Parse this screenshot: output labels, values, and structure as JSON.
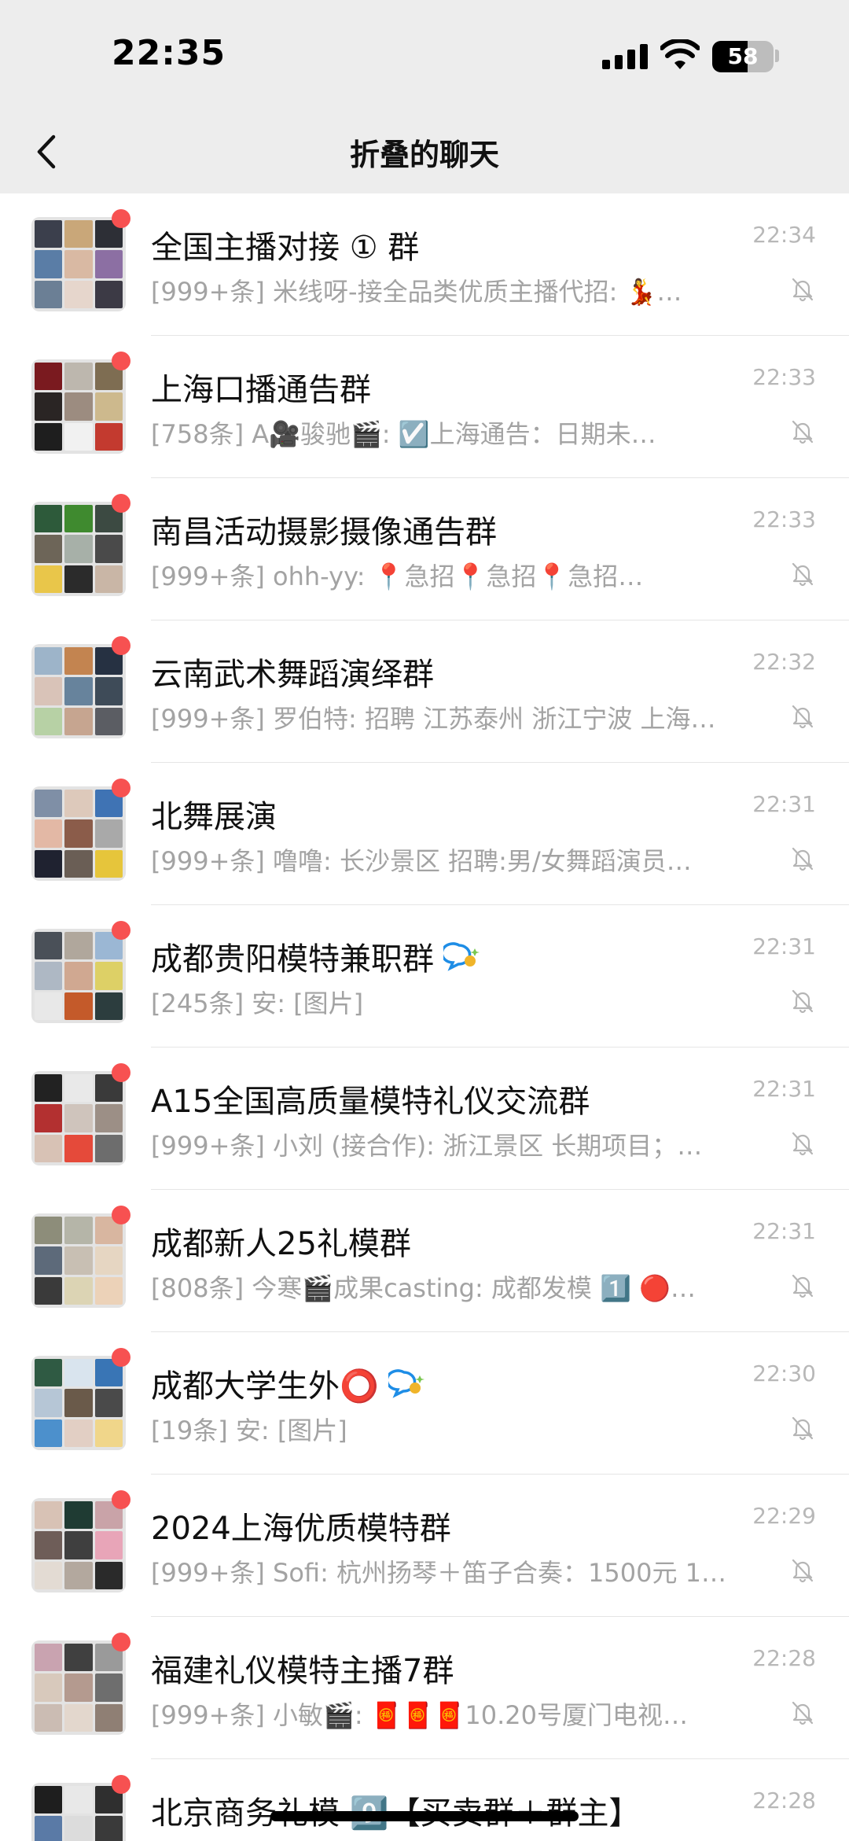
{
  "status_bar": {
    "time": "22:35",
    "battery": "58",
    "battery_level": 0.58
  },
  "header": {
    "title": "折叠的聊天"
  },
  "chats": [
    {
      "name": "全国主播对接 ① 群",
      "preview": "[999+条] 米线呀-接全品类优质主播代招: 💃…",
      "time": "22:34",
      "tiles": [
        "#3b3f4c",
        "#c9a779",
        "#2d2f36",
        "#5a7da6",
        "#d9b9a3",
        "#8c6fa3",
        "#6b7f95",
        "#e6d6cc",
        "#3c3a45"
      ]
    },
    {
      "name": "上海口播通告群",
      "preview": "[758条] A🎥骏驰🎬: ☑️上海通告：日期未…",
      "time": "22:33",
      "tiles": [
        "#7a1a1f",
        "#bdb7ae",
        "#7e6d52",
        "#2a2524",
        "#9c8c80",
        "#cdb98d",
        "#1e1e1e",
        "#f1f1f1",
        "#c33a2f"
      ]
    },
    {
      "name": "南昌活动摄影摄像通告群",
      "preview": "[999+条] ohh-yy: 📍急招📍急招📍急招…",
      "time": "22:33",
      "tiles": [
        "#2d5a3a",
        "#3f8a2f",
        "#3c4a42",
        "#6d6558",
        "#a7b0a8",
        "#4a4a4a",
        "#e9c64a",
        "#2b2b2b",
        "#c9b6a6"
      ]
    },
    {
      "name": "云南武术舞蹈演绎群",
      "preview": "[999+条] 罗伯特: 招聘 江苏泰州 浙江宁波 上海…",
      "time": "22:32",
      "tiles": [
        "#9db4c9",
        "#c38450",
        "#263142",
        "#d9c3b8",
        "#67839c",
        "#3e4b58",
        "#b7d1a5",
        "#c6a590",
        "#5b5d63"
      ]
    },
    {
      "name": "北舞展演",
      "preview": "[999+条] 噜噜: 长沙景区 招聘:男/女舞蹈演员…",
      "time": "22:31",
      "tiles": [
        "#7f8fa6",
        "#ddc9bb",
        "#3f73b4",
        "#e3b8a5",
        "#8b5c4a",
        "#a9a9a9",
        "#1f2230",
        "#6a5e55",
        "#e6c53b"
      ]
    },
    {
      "name": "成都贵阳模特兼职群",
      "preview": "[245条] 安: [图片]",
      "time": "22:31",
      "tiles": [
        "#4a5058",
        "#b0a79c",
        "#9bb7d4",
        "#aeb8c4",
        "#d0a891",
        "#ddd066",
        "#e8e8e8",
        "#c45a2a",
        "#2c3d3e"
      ]
    },
    {
      "name": "A15全国高质量模特礼仪交流群",
      "preview": "[999+条] 小刘 (接合作): 浙江景区 长期项目；…",
      "time": "22:31",
      "tiles": [
        "#222222",
        "#e9e9e9",
        "#3a3a3a",
        "#b33030",
        "#cfc4bc",
        "#9c8f86",
        "#d8c2b5",
        "#e54a3a",
        "#6d6d6d"
      ]
    },
    {
      "name": "成都新人25礼模群",
      "preview": "[808条] 今寒🎬成果casting: 成都发模 1️⃣ 🔴…",
      "time": "22:31",
      "tiles": [
        "#8d8d7a",
        "#b5b5a8",
        "#d8b6a0",
        "#5d6a7a",
        "#c8bfb3",
        "#e6d6c2",
        "#3a3a3a",
        "#dcd4b4",
        "#ecd2b8"
      ]
    },
    {
      "name": "成都大学生外⭕",
      "preview": "[19条] 安: [图片]",
      "time": "22:30",
      "tiles": [
        "#2f5a43",
        "#d9e4ee",
        "#3975b5",
        "#b6c6d6",
        "#6a5a4a",
        "#4a4a4a",
        "#4c90cc",
        "#e2cfc4",
        "#f0d68a"
      ]
    },
    {
      "name": "2024上海优质模特群",
      "preview": "[999+条] Sofi: 杭州扬琴＋笛子合奏：1500元 1…",
      "time": "22:29",
      "tiles": [
        "#d8c2b5",
        "#1f3b33",
        "#c9a3a8",
        "#6e5d58",
        "#3f3f3f",
        "#e8a5b8",
        "#e3dbd3",
        "#b3a89e",
        "#2a2a2a"
      ]
    },
    {
      "name": "福建礼仪模特主播7群",
      "preview": "[999+条] 小敏🎬: 🧧🧧🧧10.20号厦门电视…",
      "time": "22:28",
      "tiles": [
        "#c9a3b0",
        "#404040",
        "#9a9a9a",
        "#d8c9bc",
        "#b49a8f",
        "#6e6e6e",
        "#cbbcb3",
        "#e3d7cd",
        "#8f7f74"
      ]
    },
    {
      "name": "北京商务礼模 9️⃣【买卖群＋群主】",
      "preview": "",
      "time": "22:28",
      "tiles": [
        "#1e1e1e",
        "#e8e8e8",
        "#2f2f2f",
        "#5a7aa6",
        "#dcdcdc",
        "#3a3a3a",
        "#c9c9c9",
        "#8a8a8a",
        "#4a4a4a"
      ]
    }
  ]
}
